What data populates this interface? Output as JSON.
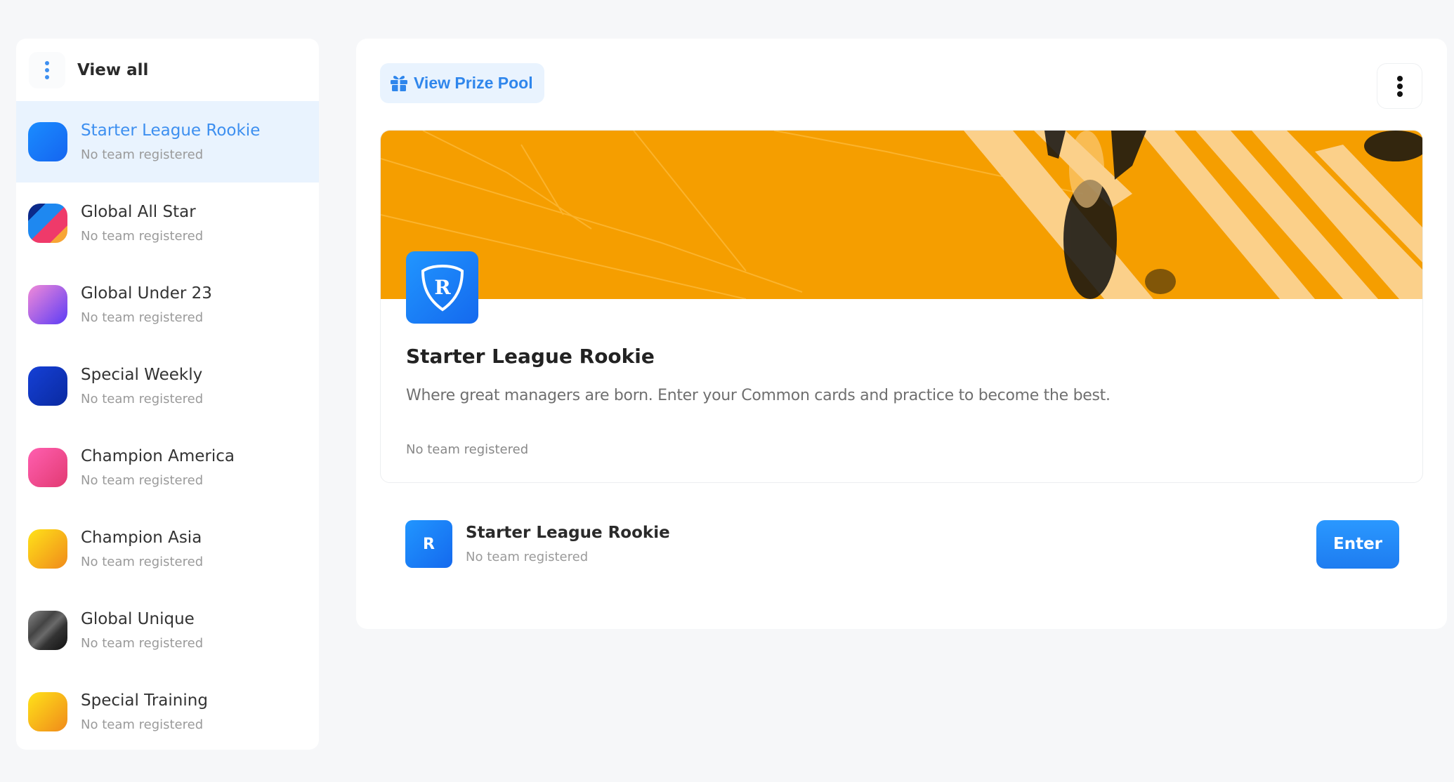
{
  "sidebar": {
    "view_all": {
      "label": "View all",
      "icon": "kebab-vertical-icon"
    },
    "items": [
      {
        "name": "Starter League Rookie",
        "status": "No team registered",
        "active": true,
        "icon_colors": [
          "#1a8cff",
          "#1565f0"
        ]
      },
      {
        "name": "Global All Star",
        "status": "No team registered",
        "active": false,
        "icon_colors": [
          "#0b2a8a",
          "#1e88f0",
          "#ef3a6a",
          "#f7a535"
        ]
      },
      {
        "name": "Global Under 23",
        "status": "No team registered",
        "active": false,
        "icon_colors": [
          "#f18ad8",
          "#5c3cf5"
        ]
      },
      {
        "name": "Special Weekly",
        "status": "No team registered",
        "active": false,
        "icon_colors": [
          "#1540d6",
          "#0a2aa0"
        ]
      },
      {
        "name": "Champion America",
        "status": "No team registered",
        "active": false,
        "icon_colors": [
          "#ff5fb0",
          "#e23a72"
        ]
      },
      {
        "name": "Champion Asia",
        "status": "No team registered",
        "active": false,
        "icon_colors": [
          "#ffe21a",
          "#f08a1a"
        ]
      },
      {
        "name": "Global Unique",
        "status": "No team registered",
        "active": false,
        "icon_colors": [
          "#777777",
          "#1a1a1a"
        ]
      },
      {
        "name": "Special Training",
        "status": "No team registered",
        "active": false,
        "icon_colors": [
          "#ffe21a",
          "#f08a1a"
        ]
      }
    ]
  },
  "main": {
    "prize_pool_button": {
      "label": "View Prize Pool",
      "icon": "gift-icon"
    },
    "more_button": {
      "icon": "kebab-vertical-icon"
    },
    "league": {
      "title": "Starter League Rookie",
      "description": "Where great managers are born. Enter your Common cards and practice to become the best.",
      "status": "No team registered",
      "logo_letter": "R",
      "banner_color": "#f59e00"
    },
    "entry": {
      "logo_letter": "R",
      "name": "Starter League Rookie",
      "status": "No team registered",
      "enter_label": "Enter"
    }
  },
  "colors": {
    "accent": "#2f86ec",
    "active_bg": "#e9f3fe",
    "banner": "#f59e00"
  }
}
